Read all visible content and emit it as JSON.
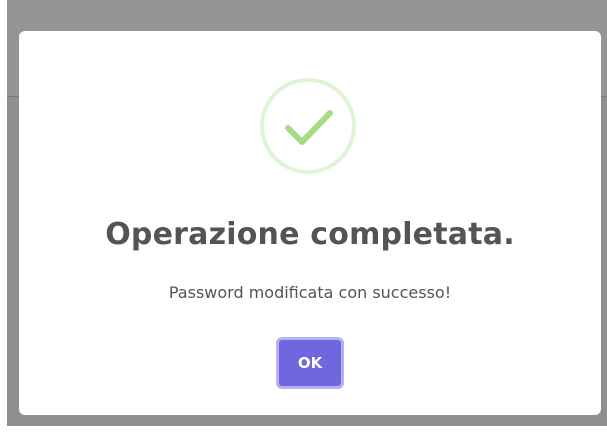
{
  "dialog": {
    "icon": "success-checkmark-icon",
    "title": "Operazione completata.",
    "message": "Password modificata con successo!",
    "confirm_label": "OK"
  },
  "colors": {
    "backdrop": "#8f8f8f",
    "icon_ring": "#dff3d7",
    "icon_check": "#a5dc86",
    "title_text": "#545454",
    "button_bg": "#7066e0",
    "button_focus_ring": "#b6b1f0"
  }
}
